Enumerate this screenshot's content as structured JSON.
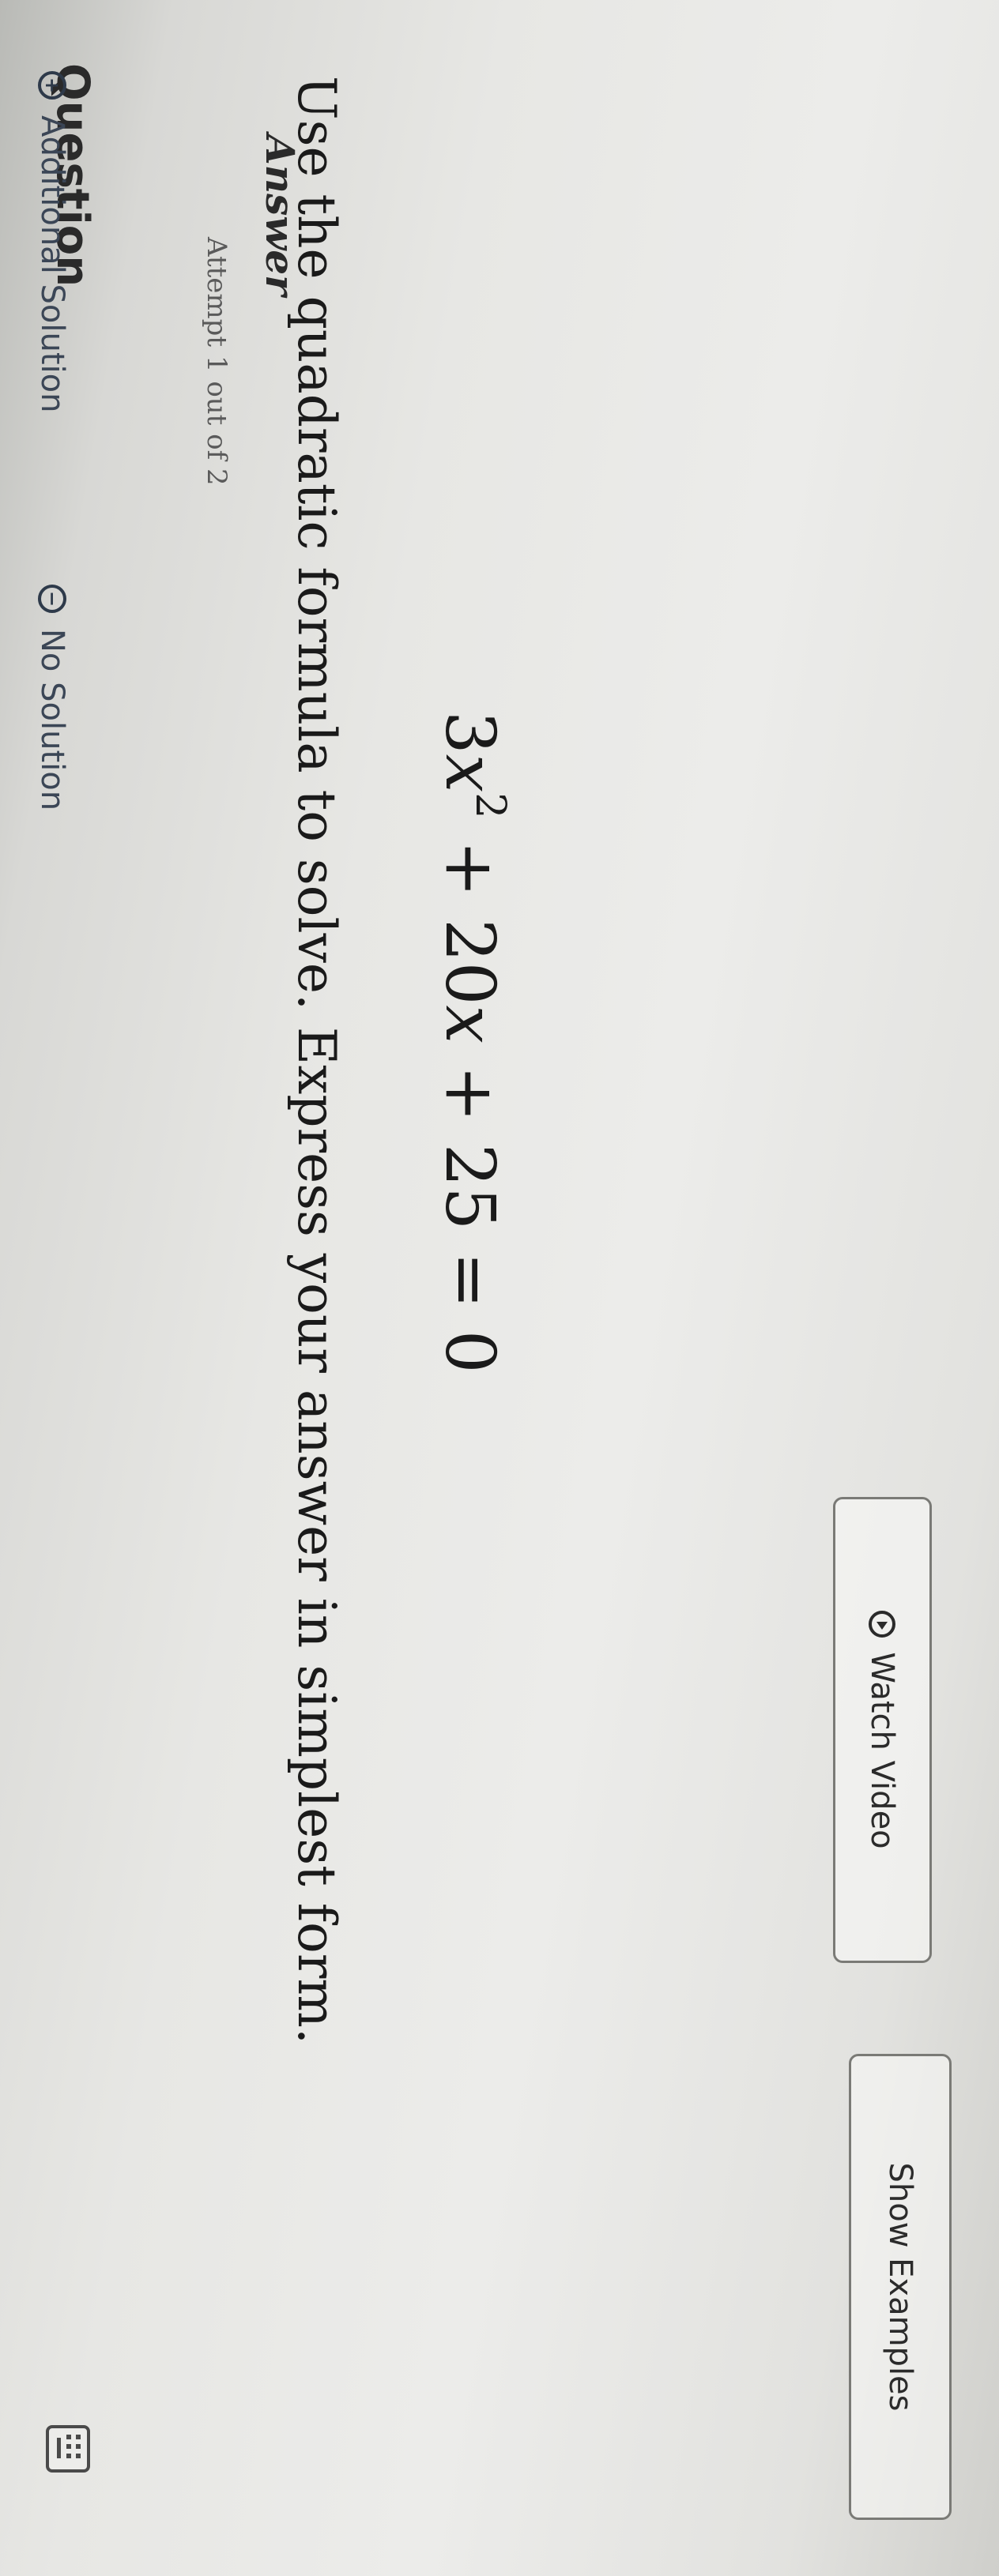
{
  "question": {
    "label": "Question",
    "instruction": "Use the quadratic formula to solve. Express your answer in simplest form.",
    "equation": {
      "coef_a": "3",
      "var": "x",
      "exponent": "2",
      "op1": " + ",
      "coef_b": "20",
      "op2": " + ",
      "constant": "25",
      "rhs": " = 0"
    }
  },
  "buttons": {
    "watch_video": "Watch Video",
    "show_examples": "Show Examples"
  },
  "answer": {
    "label": "Answer",
    "attempt": "Attempt 1 out of 2",
    "additional_solution": "Additional Solution",
    "no_solution": "No Solution"
  },
  "icons": {
    "watch_video": "play-circle-icon",
    "additional_solution": "plus-circle-icon",
    "no_solution": "minus-circle-icon",
    "keyboard": "keyboard-icon"
  }
}
